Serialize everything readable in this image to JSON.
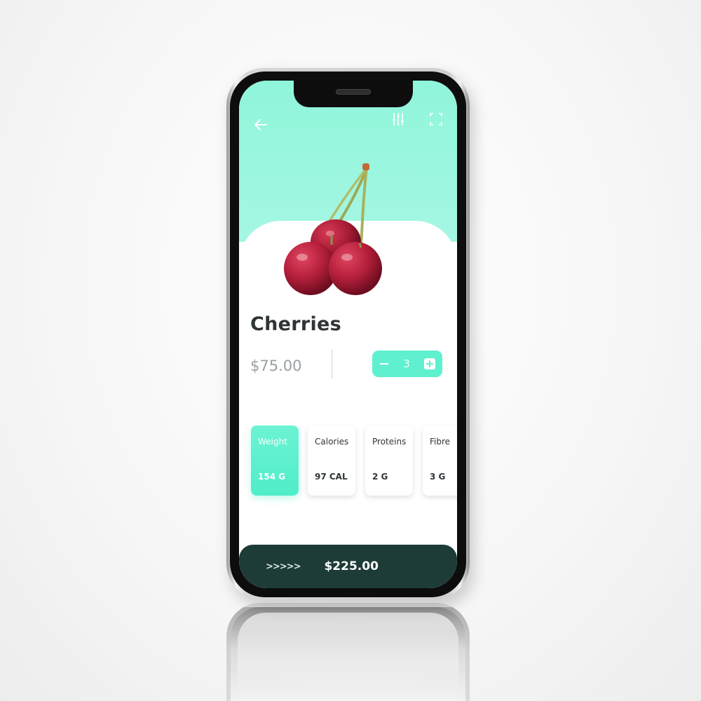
{
  "product": {
    "title": "Cherries",
    "unit_price": "$75.00"
  },
  "quantity": {
    "value": "3"
  },
  "nutrition": [
    {
      "label": "Weight",
      "value": "154 G",
      "active": true
    },
    {
      "label": "Calories",
      "value": "97 CAL",
      "active": false
    },
    {
      "label": "Proteins",
      "value": "2 G",
      "active": false
    },
    {
      "label": "Fibre",
      "value": "3 G",
      "active": false
    }
  ],
  "checkout": {
    "chevrons": ">>>>>",
    "total": "$225.00"
  },
  "icons": {
    "back": "arrow-left-icon",
    "filter": "sliders-icon",
    "scan": "scan-frame-icon",
    "product": "cherries-image"
  },
  "colors": {
    "header_mint": "#a5f7e3",
    "accent": "#5ff0cf",
    "checkout_bg": "#1d3b37",
    "title_text": "#2f3437",
    "price_text": "#9aa0a4"
  }
}
